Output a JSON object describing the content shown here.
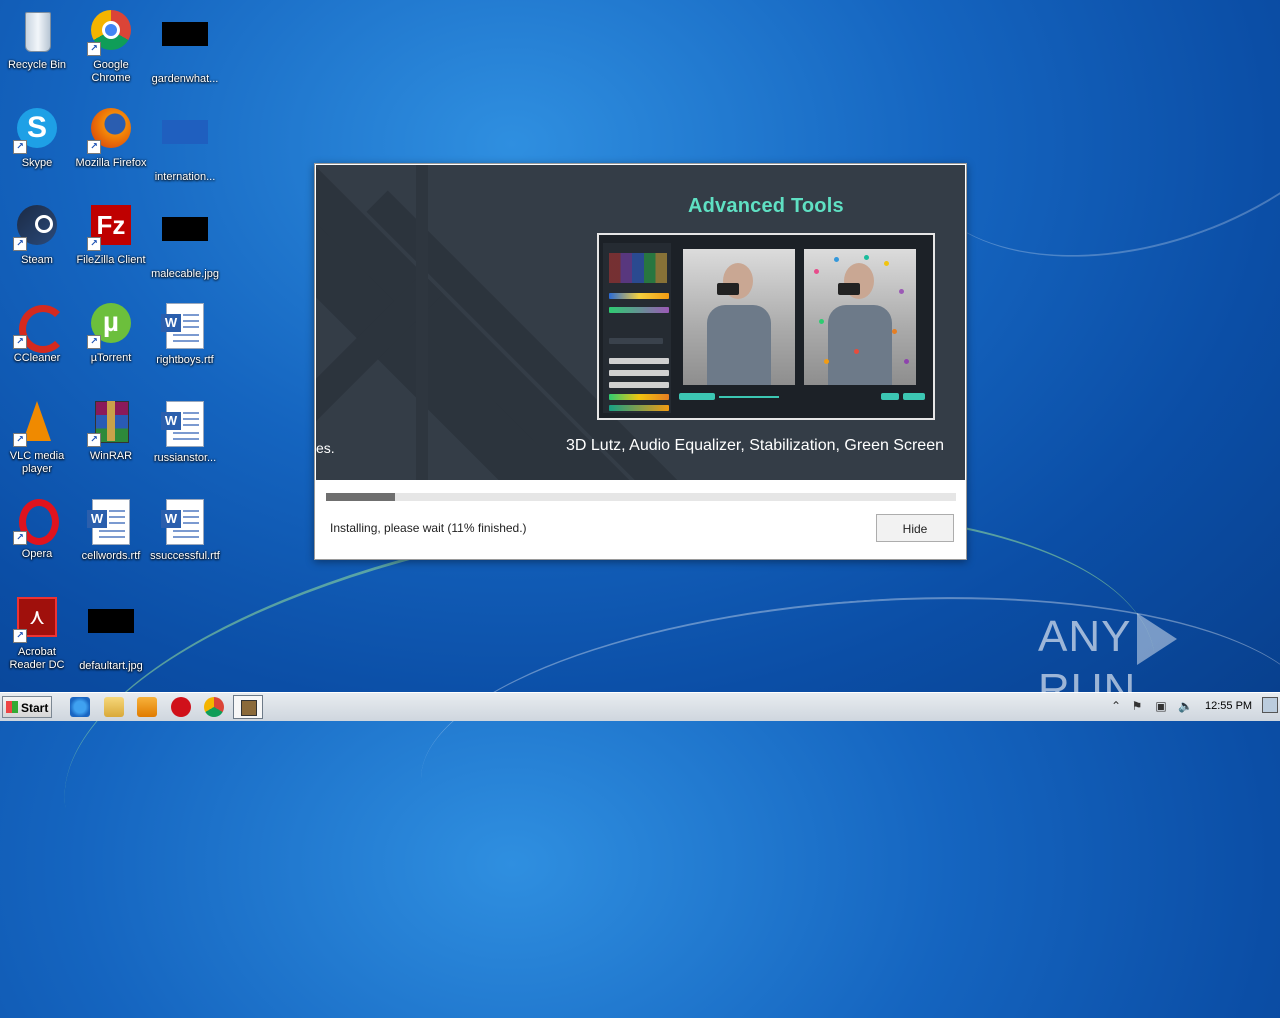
{
  "desktop": {
    "icons": [
      {
        "label": "Recycle Bin"
      },
      {
        "label": "Google Chrome"
      },
      {
        "label": "gardenwhat..."
      },
      {
        "label": "Skype"
      },
      {
        "label": "Mozilla Firefox"
      },
      {
        "label": "internation..."
      },
      {
        "label": "Steam"
      },
      {
        "label": "FileZilla Client"
      },
      {
        "label": "malecable.jpg"
      },
      {
        "label": "CCleaner"
      },
      {
        "label": "µTorrent"
      },
      {
        "label": "rightboys.rtf"
      },
      {
        "label": "VLC media player"
      },
      {
        "label": "WinRAR"
      },
      {
        "label": "russianstor..."
      },
      {
        "label": "Opera"
      },
      {
        "label": "cellwords.rtf"
      },
      {
        "label": "ssuccessful.rtf"
      },
      {
        "label": "Acrobat Reader DC"
      },
      {
        "label": "defaultart.jpg"
      }
    ]
  },
  "installer": {
    "banner_title": "Advanced Tools",
    "banner_subtitle": "3D Lutz, Audio Equalizer, Stabilization, Green Screen",
    "banner_fragment": "es.",
    "progress_percent": 11,
    "status": "Installing, please wait (11% finished.)",
    "hide_label": "Hide"
  },
  "watermark": {
    "left": "ANY",
    "right": "RUN"
  },
  "taskbar": {
    "start_label": "Start",
    "clock": "12:55 PM"
  }
}
